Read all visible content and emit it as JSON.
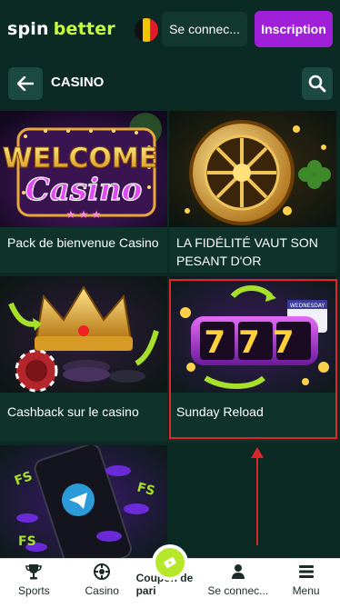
{
  "header": {
    "logo_part1": "spin",
    "logo_part2": "better",
    "connect_label": "Se connec...",
    "signup_label": "Inscription"
  },
  "subheader": {
    "title": "CASINO"
  },
  "promos": [
    {
      "label": "Pack de bienvenue Casino",
      "art_text_1": "WELCOME",
      "art_text_2": "Casino"
    },
    {
      "label_line1": "LA FIDÉLITÉ VAUT SON",
      "label_line2": "PESANT D'OR"
    },
    {
      "label": "Cashback sur le casino"
    },
    {
      "label": "Sunday Reload",
      "art_digits": "777",
      "art_calendar": "WEDNESDAY"
    },
    {
      "label": "",
      "art_fs": "FS"
    }
  ],
  "bottom_nav": [
    {
      "label": "Sports",
      "icon": "trophy-icon"
    },
    {
      "label": "Casino",
      "icon": "ball-icon"
    },
    {
      "label": "Coupon de pari",
      "icon": "ticket-icon"
    },
    {
      "label": "Se connec...",
      "icon": "user-icon"
    },
    {
      "label": "Menu",
      "icon": "menu-icon"
    }
  ],
  "colors": {
    "background": "#0b2a24",
    "brand_green": "#c6ff3a",
    "signup_purple": "#a020d9",
    "highlight_red": "#e0262b"
  }
}
